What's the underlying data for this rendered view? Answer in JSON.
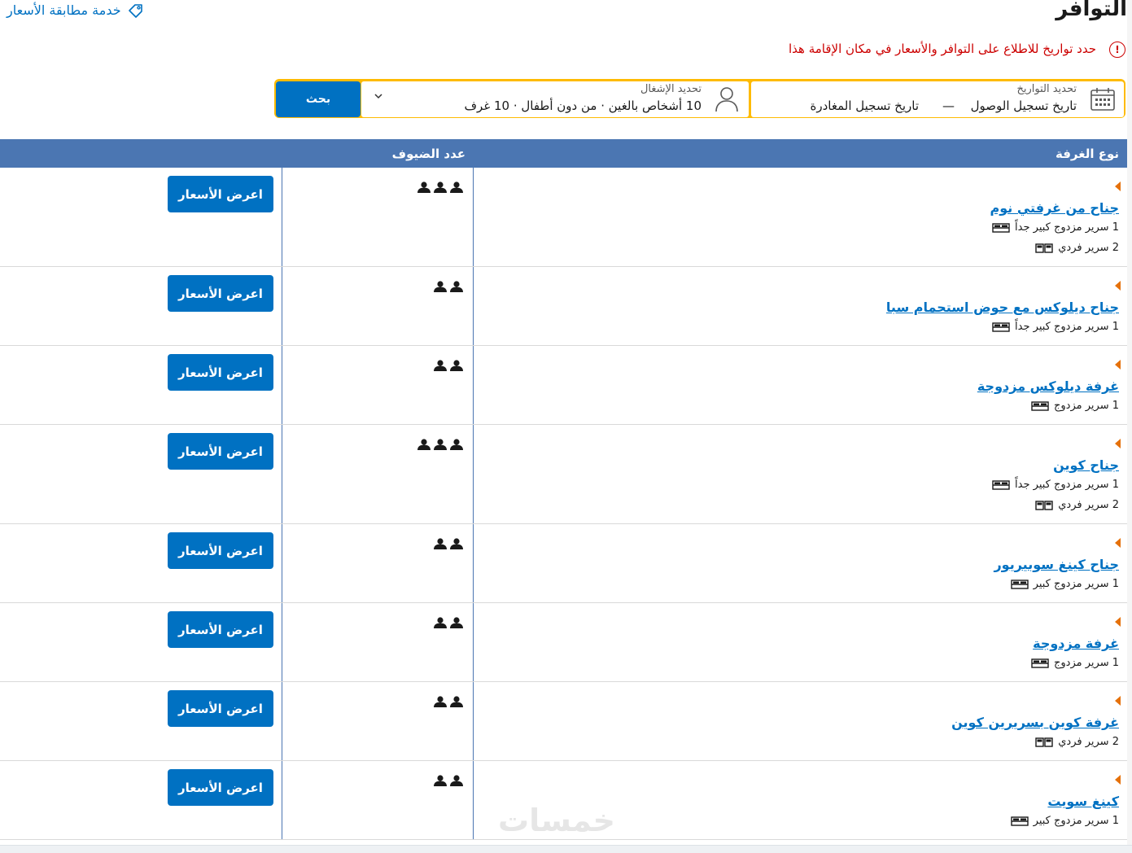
{
  "header": {
    "title": "التوافر",
    "price_match": "خدمة مطابقة الأسعار"
  },
  "notice": "حدد تواريخ للاطلاع على التوافر والأسعار في مكان الإقامة هذا",
  "search": {
    "button": "بحث",
    "occupancy_label": "تحديد الإشغال",
    "occupancy_value": "10 أشخاص بالغين · من دون أطفال · 10 غرف",
    "dates_label": "تحديد التواريخ",
    "checkin": "تاريخ تسجيل الوصول",
    "dash": "—",
    "checkout": "تاريخ تسجيل المغادرة"
  },
  "table": {
    "col_room": "نوع الغرفة",
    "col_guests": "عدد الضيوف",
    "price_button": "اعرض الأسعار",
    "rows": [
      {
        "name": "جناح من غرفتي نوم",
        "beds": [
          "1 سرير مزدوج كبير جداً",
          "2 سرير فردي"
        ],
        "guests": 3
      },
      {
        "name": "جناح ديلوكس مع حوض استحمام سبا",
        "beds": [
          "1 سرير مزدوج كبير جداً"
        ],
        "guests": 2
      },
      {
        "name": "غرفة ديلوكس مزدوجة",
        "beds": [
          "1 سرير مزدوج"
        ],
        "guests": 2
      },
      {
        "name": "جناح كوين",
        "beds": [
          "1 سرير مزدوج كبير جداً",
          "2 سرير فردي"
        ],
        "guests": 3
      },
      {
        "name": "جناح كينغ سوبيريور",
        "beds": [
          "1 سرير مزدوج كبير"
        ],
        "guests": 2
      },
      {
        "name": "غرفة مزدوجة",
        "beds": [
          "1 سرير مزدوج"
        ],
        "guests": 2
      },
      {
        "name": "غرفة كوين بسريرين كوين",
        "beds": [
          "2 سرير فردي"
        ],
        "guests": 2
      },
      {
        "name": "كينغ سويت",
        "beds": [
          "1 سرير مزدوج كبير"
        ],
        "guests": 2
      }
    ]
  },
  "watermark": "خمسات",
  "colors": {
    "accent": "#0071c2",
    "header_blue": "#4b76b2",
    "search_yellow": "#febb02",
    "alert_red": "#cc0000",
    "orange": "#e5710b"
  }
}
